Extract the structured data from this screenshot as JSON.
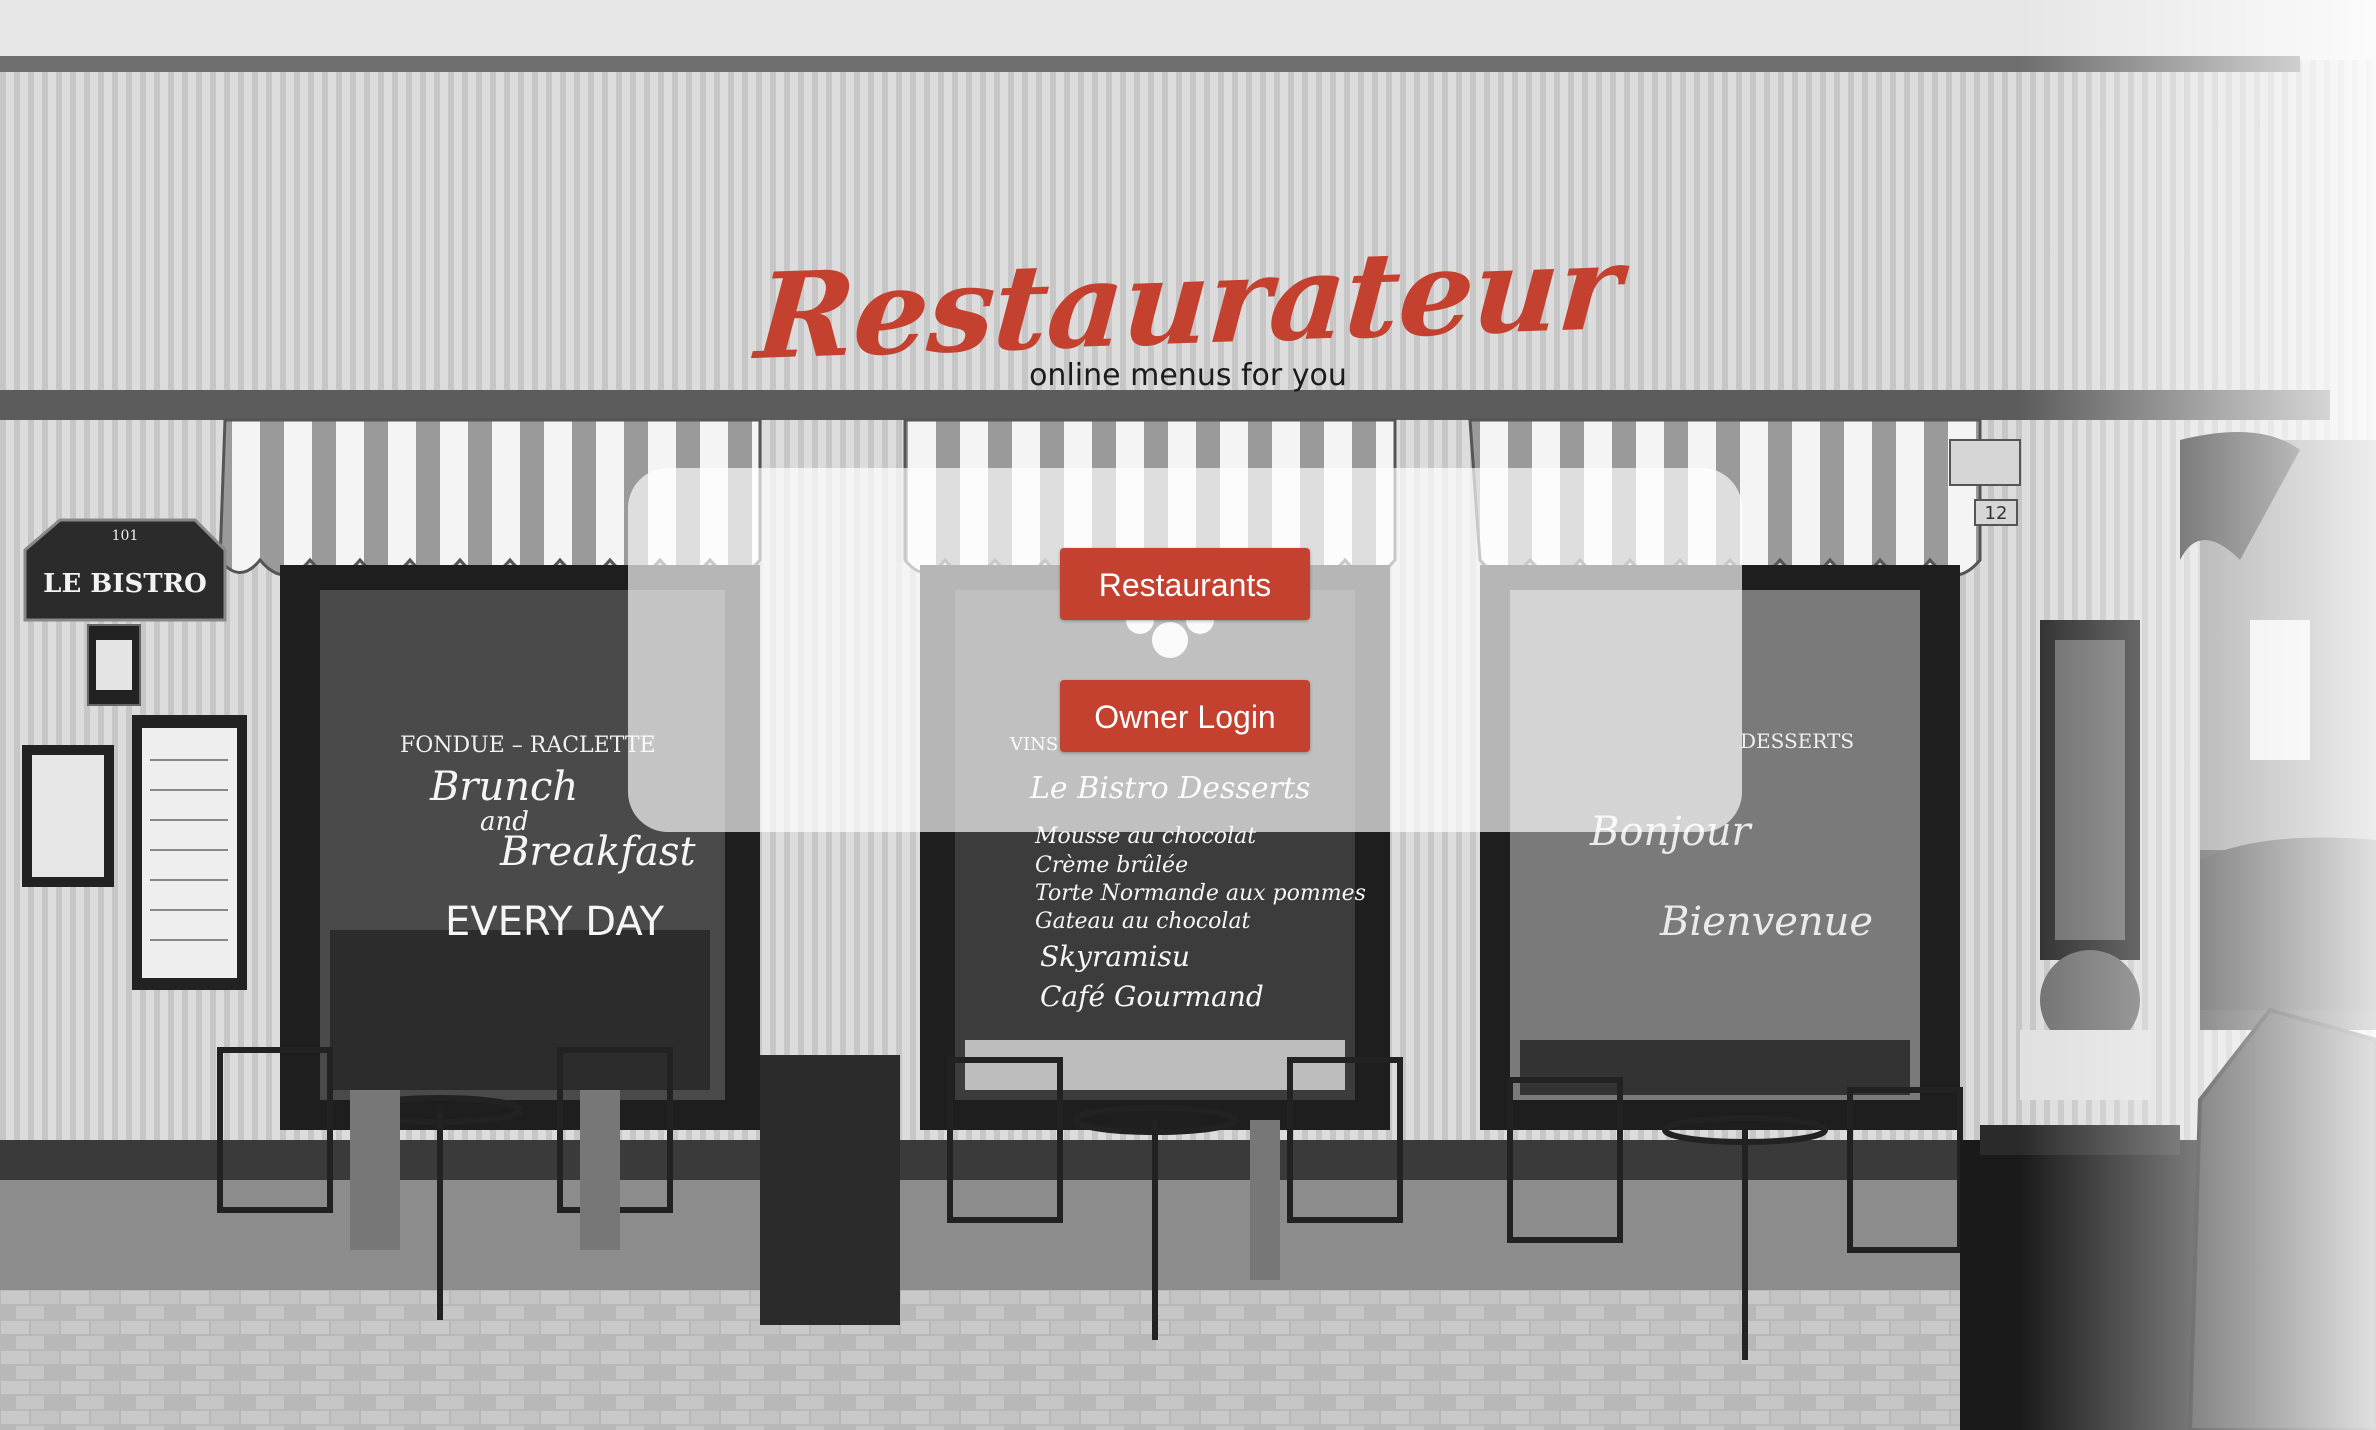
{
  "brand": {
    "logo": "Restaurateur",
    "tagline": "online menus for you"
  },
  "actions": {
    "restaurants_label": "Restaurants",
    "owner_login_label": "Owner Login"
  },
  "background": {
    "storefront_sign": "LE BISTRO",
    "sign_number": "101",
    "window_text_left": [
      "FONDUE - RACLETTE",
      "Brunch",
      "and",
      "Breakfast",
      "EVERY DAY"
    ],
    "window_text_center": [
      "VINS - BIERES - COCKTAILS",
      "Le Bistro Desserts",
      "Mousse au chocolat",
      "Crème brûlée",
      "Torte Normande aux pommes",
      "Gateau au chocolat",
      "Skyramisu",
      "Café Gourmand"
    ],
    "window_text_right": [
      "DESSERTS",
      "Bonjour",
      "Bienvenue"
    ],
    "street_number": "12"
  },
  "colors": {
    "accent": "#c4402f",
    "panel": "rgba(255,255,255,0.68)"
  }
}
